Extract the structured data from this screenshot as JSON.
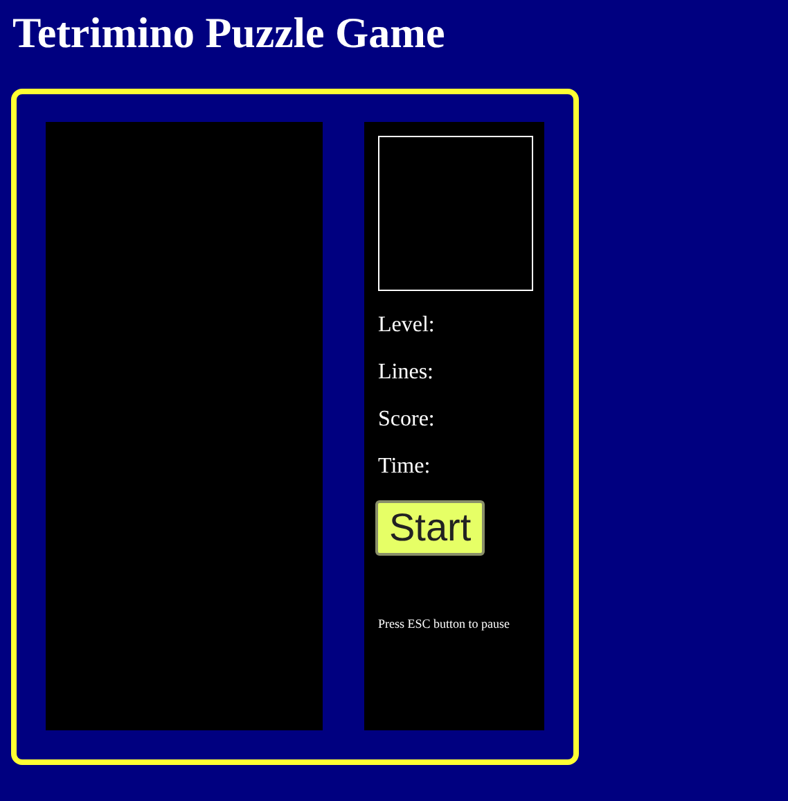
{
  "title": "Tetrimino Puzzle Game",
  "stats": [
    {
      "label": "Level:"
    },
    {
      "label": "Lines:"
    },
    {
      "label": "Score:"
    },
    {
      "label": "Time:"
    }
  ],
  "start_button": "Start",
  "hint": "Press ESC button to pause"
}
